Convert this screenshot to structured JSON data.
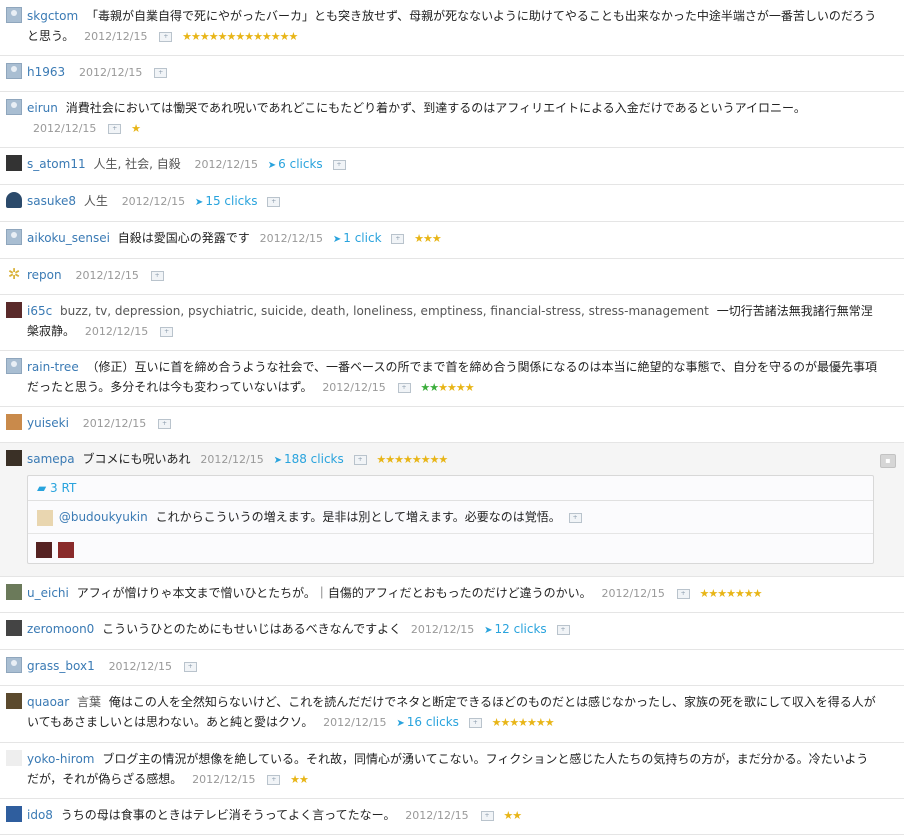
{
  "bookmarks": [
    {
      "user": "skgctom",
      "tags": "",
      "text": "「毒親が自業自得で死にやがったバーカ」とも突き放せず、母親が死なないように助けてやることも出来なかった中途半端さが一番苦しいのだろうと思う。",
      "date": "2012/12/15",
      "clicks": "",
      "stars": 13,
      "green": 0
    },
    {
      "user": "h1963",
      "tags": "",
      "text": "",
      "date": "2012/12/15",
      "clicks": "",
      "stars": 0,
      "green": 0
    },
    {
      "user": "eirun",
      "tags": "",
      "text": "消費社会においては慟哭であれ呪いであれどこにもたどり着かず、到達するのはアフィリエイトによる入金だけであるというアイロニー。",
      "date": "2012/12/15",
      "clicks": "",
      "stars": 1,
      "green": 0
    },
    {
      "user": "s_atom11",
      "tags": "人生, 社会, 自殺",
      "text": "",
      "date": "2012/12/15",
      "clicks": "6 clicks",
      "stars": 0,
      "green": 0
    },
    {
      "user": "sasuke8",
      "tags": "人生",
      "text": "",
      "date": "2012/12/15",
      "clicks": "15 clicks",
      "stars": 0,
      "green": 0
    },
    {
      "user": "aikoku_sensei",
      "tags": "",
      "text": "自殺は愛国心の発露です",
      "date": "2012/12/15",
      "clicks": "1 click",
      "stars": 3,
      "green": 0
    },
    {
      "user": "repon",
      "tags": "",
      "text": "",
      "date": "2012/12/15",
      "clicks": "",
      "stars": 0,
      "green": 0
    },
    {
      "user": "i65c",
      "tags": "buzz, tv, depression, psychiatric, suicide, death, loneliness, emptiness, financial-stress, stress-management",
      "text": "一切行苦諸法無我諸行無常涅槃寂静。",
      "date": "2012/12/15",
      "clicks": "",
      "stars": 0,
      "green": 0
    },
    {
      "user": "rain-tree",
      "tags": "",
      "text": "（修正）互いに首を締め合うような社会で、一番ベースの所でまで首を締め合う関係になるのは本当に絶望的な事態で、自分を守るのが最優先事項だったと思う。多分それは今も変わっていないはず。",
      "date": "2012/12/15",
      "clicks": "",
      "stars": 4,
      "green": 2
    },
    {
      "user": "yuiseki",
      "tags": "",
      "text": "",
      "date": "2012/12/15",
      "clicks": "",
      "stars": 0,
      "green": 0
    },
    {
      "user": "samepa",
      "tags": "",
      "text": "ブコメにも呪いあれ",
      "date": "2012/12/15",
      "clicks": "188 clicks",
      "stars": 8,
      "green": 0,
      "rt": {
        "count": "3 RT",
        "reply_user": "@budoukyukin",
        "reply_text": "これからこういうの増えます。是非は別として増えます。必要なのは覚悟。"
      }
    },
    {
      "user": "u_eichi",
      "tags": "",
      "text": "アフィが憎けりゃ本文まで憎いひとたちが。｜自傷的アフィだとおもったのだけど違うのかい。",
      "date": "2012/12/15",
      "clicks": "",
      "stars": 7,
      "green": 0
    },
    {
      "user": "zeromoon0",
      "tags": "",
      "text": "こういうひとのためにもせいじはあるべきなんですよく",
      "date": "2012/12/15",
      "clicks": "12 clicks",
      "stars": 0,
      "green": 0
    },
    {
      "user": "grass_box1",
      "tags": "",
      "text": "",
      "date": "2012/12/15",
      "clicks": "",
      "stars": 0,
      "green": 0
    },
    {
      "user": "quaoar",
      "tags": "言葉",
      "text": "俺はこの人を全然知らないけど、これを読んだだけでネタと断定できるほどのものだとは感じなかったし、家族の死を歌にして収入を得る人がいてもあさましいとは思わない。あと純と愛はクソ。",
      "date": "2012/12/15",
      "clicks": "16 clicks",
      "stars": 7,
      "green": 0
    },
    {
      "user": "yoko-hirom",
      "tags": "",
      "text": "ブログ主の情況が想像を絶している。それ故，同情心が湧いてこない。フィクションと感じた人たちの気持ちの方が，まだ分かる。冷たいようだが，それが偽らざる感想。",
      "date": "2012/12/15",
      "clicks": "",
      "stars": 2,
      "green": 0
    },
    {
      "user": "ido8",
      "tags": "",
      "text": "うちの母は食事のときはテレビ消そうってよく言ってたなー。",
      "date": "2012/12/15",
      "clicks": "",
      "stars": 2,
      "green": 0
    }
  ],
  "colors": {
    "link": "#3a7ab4",
    "twitter": "#29a3dd",
    "star": "#e8b517",
    "green_star": "#3cae3c"
  },
  "icons": {
    "avatar": "user-avatar-icon",
    "bookmark": "add-bookmark-icon",
    "twitter": "twitter-bird-icon",
    "star": "star-icon",
    "comment": "comment-bubble-icon"
  }
}
